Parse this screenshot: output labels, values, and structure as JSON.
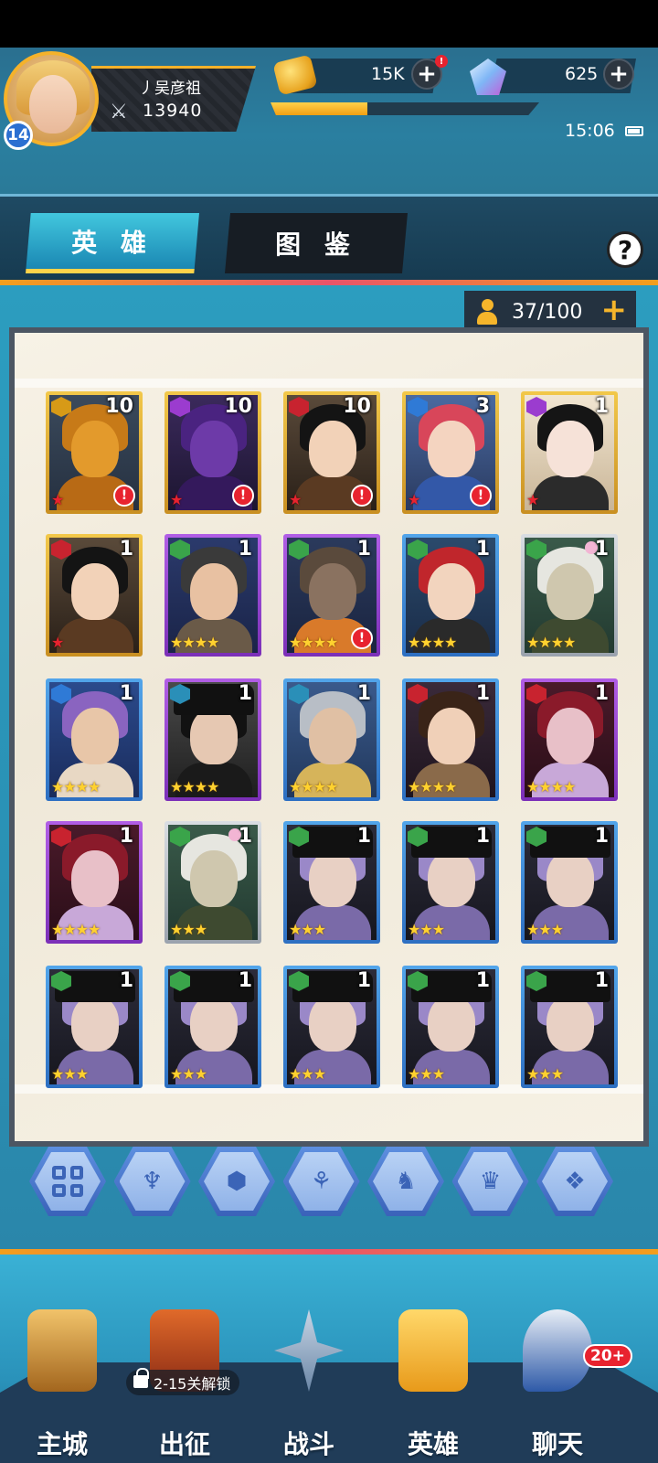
{
  "player": {
    "name": "丿吴彦祖",
    "power": "13940",
    "level": "14"
  },
  "resources": {
    "coins": "15K",
    "coins_alert": "!",
    "gems": "625",
    "xp_fraction": 0.36
  },
  "clock": {
    "time": "15:06"
  },
  "tabs": {
    "heroes": "英 雄",
    "codex": "图 鉴",
    "help": "?"
  },
  "roster": {
    "count": "37/100",
    "plus": "+"
  },
  "heroes": [
    {
      "level": "10",
      "frame": "gold",
      "faction": "gold",
      "stars": "★",
      "star_color": "red",
      "alert": true,
      "look": "mech"
    },
    {
      "level": "10",
      "frame": "gold",
      "faction": "purple",
      "stars": "★",
      "star_color": "red",
      "alert": true,
      "look": "demon"
    },
    {
      "level": "10",
      "frame": "gold",
      "faction": "red",
      "stars": "★",
      "star_color": "red",
      "alert": true,
      "look": "warrior"
    },
    {
      "level": "3",
      "frame": "gold",
      "faction": "blue",
      "stars": "★",
      "star_color": "red",
      "alert": true,
      "look": "redhair"
    },
    {
      "level": "1",
      "frame": "gold",
      "faction": "purple",
      "stars": "★",
      "star_color": "red",
      "alert": false,
      "look": "queen"
    },
    {
      "level": "1",
      "frame": "gold",
      "faction": "red",
      "stars": "★",
      "star_color": "red",
      "alert": false,
      "look": "warrior"
    },
    {
      "level": "1",
      "frame": "purple",
      "faction": "green",
      "stars": "★★★★",
      "star_color": "gold",
      "alert": false,
      "look": "boy"
    },
    {
      "level": "1",
      "frame": "purple",
      "faction": "green",
      "stars": "★★★★",
      "star_color": "gold",
      "alert": true,
      "look": "wolf"
    },
    {
      "level": "1",
      "frame": "blue",
      "faction": "green",
      "stars": "★★★★",
      "star_color": "gold",
      "alert": false,
      "look": "riding"
    },
    {
      "level": "1",
      "frame": "silver",
      "faction": "green",
      "stars": "★★★★",
      "star_color": "gold",
      "alert": false,
      "look": "elf"
    },
    {
      "level": "1",
      "frame": "blue",
      "faction": "blue",
      "stars": "★★★★",
      "star_color": "gold",
      "alert": false,
      "look": "mohawk"
    },
    {
      "level": "1",
      "frame": "purple",
      "faction": "teal",
      "stars": "★★★★",
      "star_color": "gold",
      "alert": false,
      "look": "officer"
    },
    {
      "level": "1",
      "frame": "blue",
      "faction": "teal",
      "stars": "★★★★",
      "star_color": "gold",
      "alert": false,
      "look": "viking"
    },
    {
      "level": "1",
      "frame": "blue",
      "faction": "red",
      "stars": "★★★★",
      "star_color": "gold",
      "alert": false,
      "look": "priestess"
    },
    {
      "level": "1",
      "frame": "purple",
      "faction": "red",
      "stars": "★★★★",
      "star_color": "gold",
      "alert": false,
      "look": "veiled"
    },
    {
      "level": "1",
      "frame": "purple",
      "faction": "red",
      "stars": "★★★★",
      "star_color": "gold",
      "alert": false,
      "look": "veiled"
    },
    {
      "level": "1",
      "frame": "silver",
      "faction": "green",
      "stars": "★★★",
      "star_color": "gold",
      "alert": false,
      "look": "elf"
    },
    {
      "level": "1",
      "frame": "blue",
      "faction": "green",
      "stars": "★★★",
      "star_color": "gold",
      "alert": false,
      "look": "hat"
    },
    {
      "level": "1",
      "frame": "blue",
      "faction": "green",
      "stars": "★★★",
      "star_color": "gold",
      "alert": false,
      "look": "hat"
    },
    {
      "level": "1",
      "frame": "blue",
      "faction": "green",
      "stars": "★★★",
      "star_color": "gold",
      "alert": false,
      "look": "hat"
    },
    {
      "level": "1",
      "frame": "blue",
      "faction": "green",
      "stars": "★★★",
      "star_color": "gold",
      "alert": false,
      "look": "hat"
    },
    {
      "level": "1",
      "frame": "blue",
      "faction": "green",
      "stars": "★★★",
      "star_color": "gold",
      "alert": false,
      "look": "hat"
    },
    {
      "level": "1",
      "frame": "blue",
      "faction": "green",
      "stars": "★★★",
      "star_color": "gold",
      "alert": false,
      "look": "hat"
    },
    {
      "level": "1",
      "frame": "blue",
      "faction": "green",
      "stars": "★★★",
      "star_color": "gold",
      "alert": false,
      "look": "hat"
    },
    {
      "level": "1",
      "frame": "blue",
      "faction": "green",
      "stars": "★★★",
      "star_color": "gold",
      "alert": false,
      "look": "hat"
    }
  ],
  "filters": [
    "all-icon",
    "faction-blue-icon",
    "faction-teal-icon",
    "faction-lotus-icon",
    "faction-beast-icon",
    "faction-purple-icon",
    "faction-gold-icon"
  ],
  "nav": {
    "items": [
      {
        "id": "main-city",
        "label": "主城",
        "icon": "book-icon"
      },
      {
        "id": "expedition",
        "label": "出征",
        "icon": "ship-icon"
      },
      {
        "id": "battle",
        "label": "战斗",
        "icon": "crossed-swords-icon"
      },
      {
        "id": "heroes",
        "label": "英雄",
        "icon": "helmet-icon"
      },
      {
        "id": "chat",
        "label": "聊天",
        "icon": "chat-icon"
      }
    ],
    "lock_text": "2-15关解锁",
    "chat_badge": "20+"
  },
  "colors": {
    "accent_gold": "#f5b22b",
    "alert_red": "#e8232f"
  }
}
